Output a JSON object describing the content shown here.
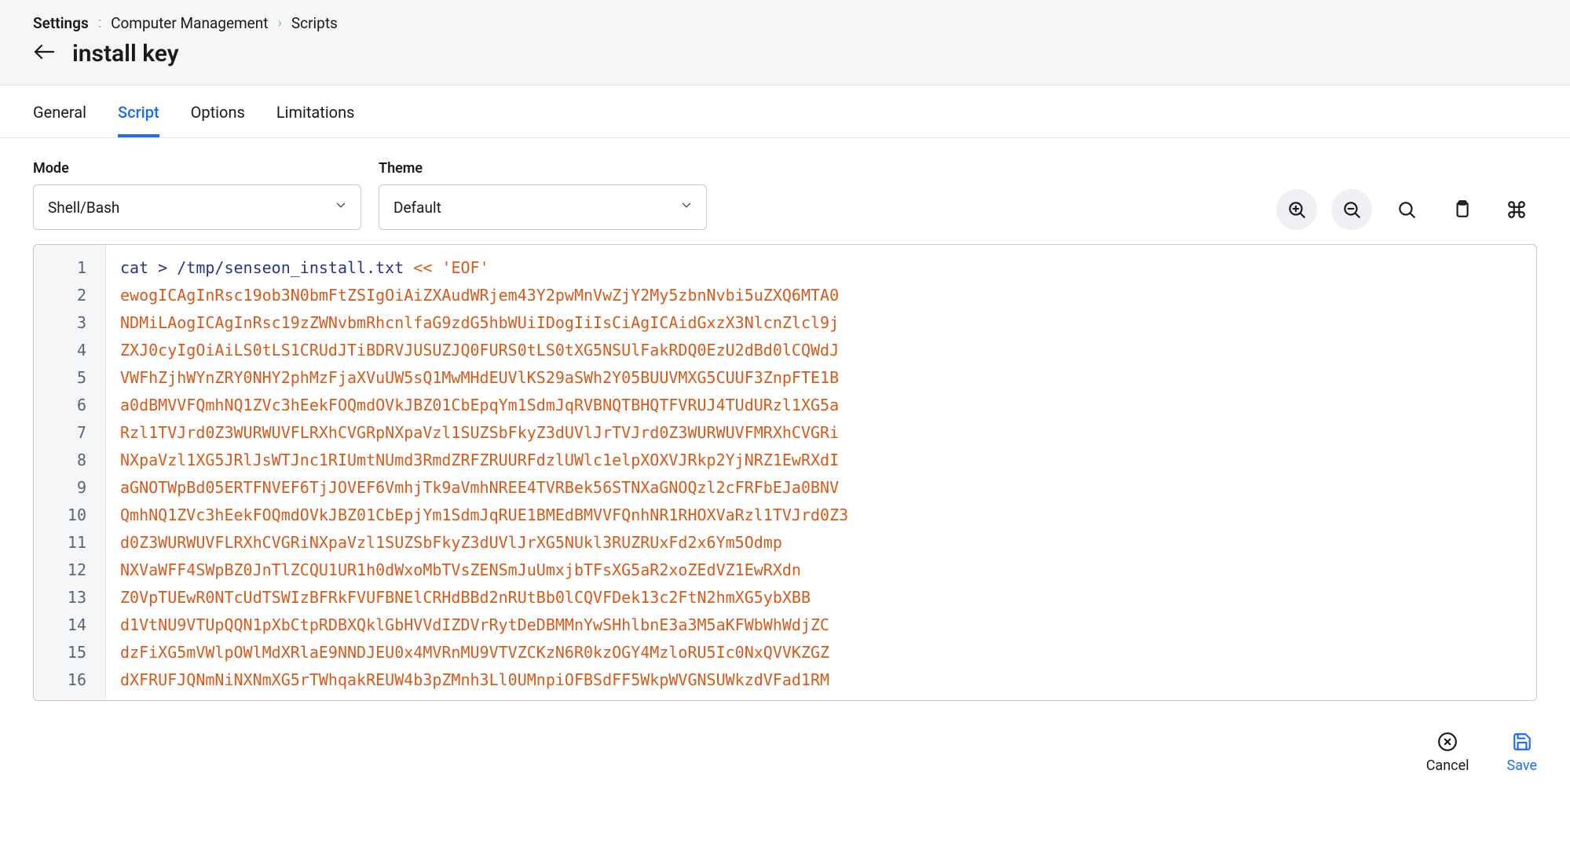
{
  "breadcrumb": {
    "root": "Settings",
    "sep1": ":",
    "mid": "Computer Management",
    "sep2": "›",
    "leaf": "Scripts"
  },
  "header": {
    "title": "install key"
  },
  "tabs": [
    "General",
    "Script",
    "Options",
    "Limitations"
  ],
  "activeTab": "Script",
  "fields": {
    "mode": {
      "label": "Mode",
      "value": "Shell/Bash"
    },
    "theme": {
      "label": "Theme",
      "value": "Default"
    }
  },
  "toolbar": {
    "zoom_in": "zoom-in",
    "zoom_out": "zoom-out",
    "search": "search",
    "copy": "copy",
    "command": "command"
  },
  "editor": {
    "first_line": {
      "cmd": "cat > /tmp/senseon_install.txt",
      "op": "<<",
      "str": "'EOF'"
    },
    "lines": [
      "ewogICAgInRsc19ob3N0bmFtZSIgOiAiZXAudWRjem43Y2pwMnVwZjY2My5zbnNvbi5uZXQ6MTA0",
      "NDMiLAogICAgInRsc19zZWNvbmRhcnlfaG9zdG5hbWUiIDogIiIsCiAgICAidGxzX3NlcnZlcl9j",
      "ZXJ0cyIgOiAiLS0tLS1CRUdJTiBDRVJUSUZJQ0FURS0tLS0tXG5NSUlFakRDQ0EzU2dBd0lCQWdJ",
      "VWFhZjhWYnZRY0NHY2phMzFjaXVuUW5sQ1MwMHdEUVlKS29aSWh2Y05BUUVMXG5CUUF3ZnpFTE1B",
      "a0dBMVVFQmhNQ1ZVc3hEekFOQmdOVkJBZ01CbEpqYm1SdmJqRVBNQTBHQTFVRUJ4TUdURzl1XG5a",
      "Rzl1TVJrd0Z3WURWUVFLRXhCVGRpNXpaVzl1SUZSbFkyZ3dUVlJrTVJrd0Z3WURWUVFMRXhCVGRi",
      "NXpaVzl1XG5JRlJsWTJnc1RIUmtNUmd3RmdZRFZRUURFdzlUWlc1elpXOXVJRkp2YjNRZ1EwRXdI",
      "aGNOTWpBd05ERTFNVEF6TjJOVEF6VmhjTk9aVmhNREE4TVRBek56STNXaGNOQzl2cFRFbEJa0BNV",
      "QmhNQ1ZVc3hEekFOQmdOVkJBZ01CbEpjYm1SdmJqRUE1BMEdBMVVFQnhNR1RHOXVaRzl1TVJrd0Z3",
      "d0Z3WURWUVFLRXhCVGRiNXpaVzl1SUZSbFkyZ3dUVlJrXG5NUkl3RUZRUxFd2x6Ym5Odmp",
      "NXVaWFF4SWpBZ0JnTlZCQU1UR1h0dWxoMbTVsZENSmJuUmxjbTFsXG5aR2xoZEdVZ1EwRXdn",
      "Z0VpTUEwR0NTcUdTSWIzBFRkFVUFBNElCRHdBBd2nRUtBb0lCQVFDek13c2FtN2hmXG5ybXBB",
      "d1VtNU9VTUpQQN1pXbCtpRDBXQklGbHVVdIZDVrRytDeDBMMnYwSHhlbnE3a3M5aKFWbWhWdjZC",
      "dzFiXG5mVWlpOWlMdXRlaE9NNDJEU0x4MVRnMU9VTVZCKzN6R0kzOGY4MzloRU5Ic0NxQVVKZGZ",
      "dXFRUFJQNmNiNXNmXG5rTWhqakREUW4b3pZMnh3Ll0UMnpiOFBSdFF5WkpWVGNSUWkzdVFad1RM"
    ]
  },
  "footer": {
    "cancel": "Cancel",
    "save": "Save"
  }
}
